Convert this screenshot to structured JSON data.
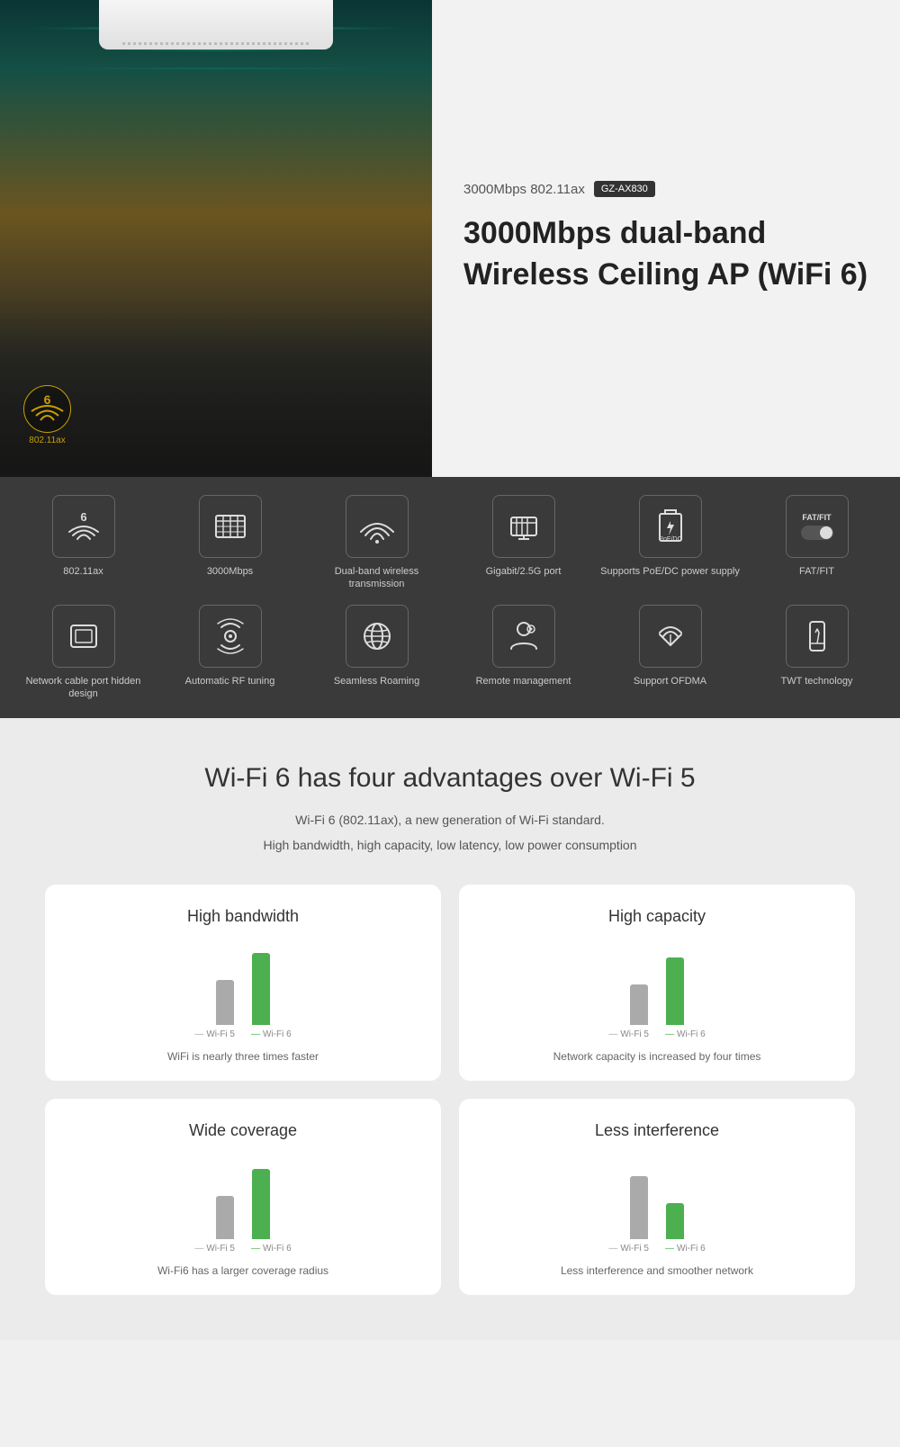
{
  "hero": {
    "speed": "3000Mbps 802.11ax",
    "model_badge": "GZ-AX830",
    "title_line1": "3000Mbps dual-band",
    "title_line2": "Wireless Ceiling AP (WiFi 6)",
    "wifi_standard": "802.11ax"
  },
  "features": {
    "row1": [
      {
        "id": "wifi6",
        "label": "802.11ax",
        "icon_type": "wifi6"
      },
      {
        "id": "speed",
        "label": "3000Mbps",
        "icon_type": "speed"
      },
      {
        "id": "dualband",
        "label": "Dual-band wireless transmission",
        "icon_type": "dualband"
      },
      {
        "id": "gigabit",
        "label": "Gigabit/2.5G port",
        "icon_type": "gigabit"
      },
      {
        "id": "poe",
        "label": "Supports PoE/DC power supply",
        "icon_type": "poe"
      },
      {
        "id": "fatfit",
        "label": "FAT/FIT",
        "icon_type": "fatfit"
      }
    ],
    "row2": [
      {
        "id": "hidden",
        "label": "Network cable port hidden design",
        "icon_type": "hidden"
      },
      {
        "id": "rf",
        "label": "Automatic RF tuning",
        "icon_type": "rf"
      },
      {
        "id": "roaming",
        "label": "Seamless Roaming",
        "icon_type": "roaming"
      },
      {
        "id": "remote",
        "label": "Remote management",
        "icon_type": "remote"
      },
      {
        "id": "ofdma",
        "label": "Support OFDMA",
        "icon_type": "ofdma"
      },
      {
        "id": "twt",
        "label": "TWT technology",
        "icon_type": "twt"
      }
    ]
  },
  "wifi6_section": {
    "title": "Wi-Fi 6 has four advantages over Wi-Fi 5",
    "desc_line1": "Wi-Fi 6 (802.11ax), a new generation of Wi-Fi standard.",
    "desc_line2": "High bandwidth, high capacity, low latency, low power consumption",
    "advantages": [
      {
        "id": "bandwidth",
        "title": "High bandwidth",
        "wifi5_height": 50,
        "wifi6_height": 80,
        "label_wifi5": "Wi-Fi 5",
        "label_wifi6": "Wi-Fi 6",
        "desc": "WiFi is nearly three times faster"
      },
      {
        "id": "capacity",
        "title": "High capacity",
        "wifi5_height": 45,
        "wifi6_height": 75,
        "label_wifi5": "Wi-Fi 5",
        "label_wifi6": "Wi-Fi 6",
        "desc": "Network capacity is increased by four times"
      },
      {
        "id": "coverage",
        "title": "Wide coverage",
        "wifi5_height": 48,
        "wifi6_height": 78,
        "label_wifi5": "Wi-Fi 5",
        "label_wifi6": "Wi-Fi 6",
        "desc": "Wi-Fi6 has a larger coverage radius"
      },
      {
        "id": "interference",
        "title": "Less interference",
        "wifi5_height": 70,
        "wifi6_height": 40,
        "label_wifi5": "Wi-Fi 5",
        "label_wifi6": "Wi-Fi 6",
        "desc": "Less interference and smoother network"
      }
    ]
  }
}
